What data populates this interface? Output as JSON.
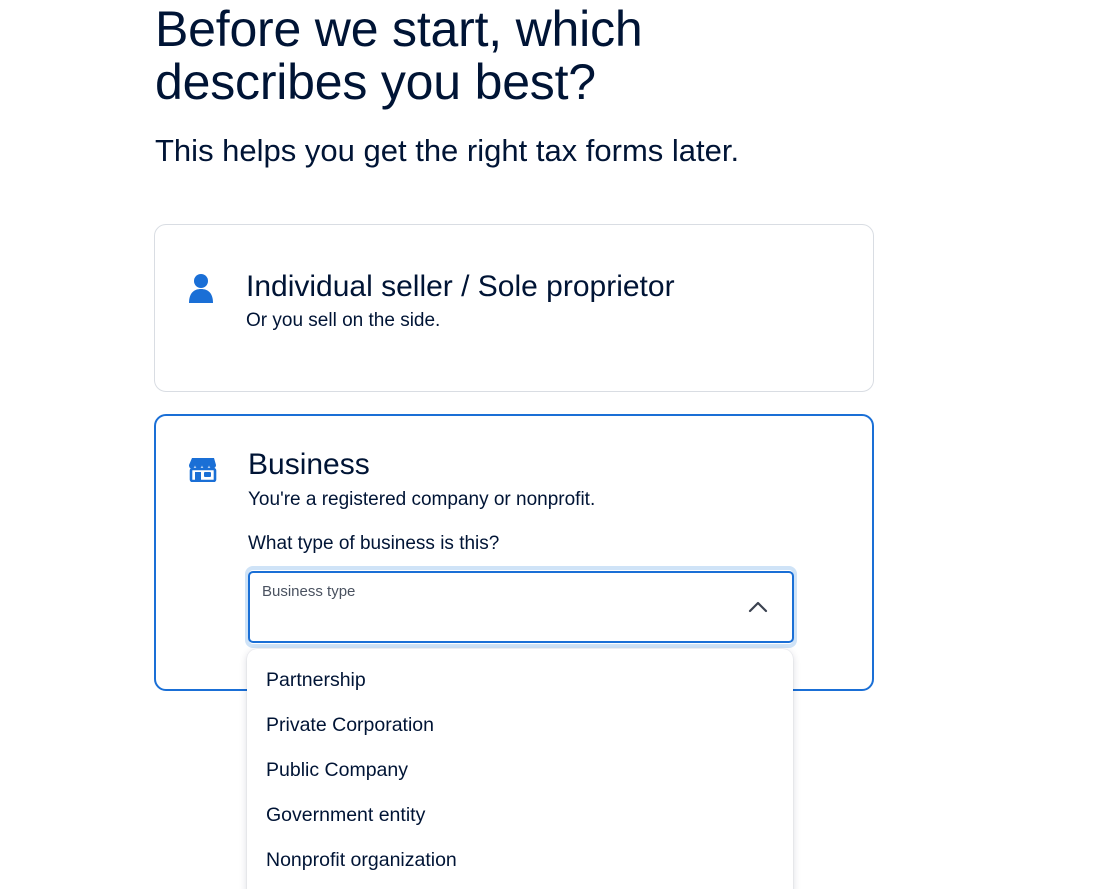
{
  "header": {
    "title": "Before we start, which describes you best?",
    "subtitle": "This helps you get the right tax forms later."
  },
  "options": {
    "individual": {
      "icon": "person-icon",
      "title": "Individual seller / Sole proprietor",
      "description": "Or you sell on the side."
    },
    "business": {
      "icon": "storefront-icon",
      "title": "Business",
      "description": "You're a registered company or nonprofit.",
      "question": "What type of business is this?",
      "select": {
        "label": "Business type",
        "value": "",
        "expanded": true,
        "options": [
          "Partnership",
          "Private Corporation",
          "Public Company",
          "Government entity",
          "Nonprofit organization"
        ]
      }
    }
  },
  "colors": {
    "accent": "#1a6fd6",
    "text": "#001435",
    "focus_ring": "#cfe3f7",
    "card_border": "#d9dde3"
  }
}
